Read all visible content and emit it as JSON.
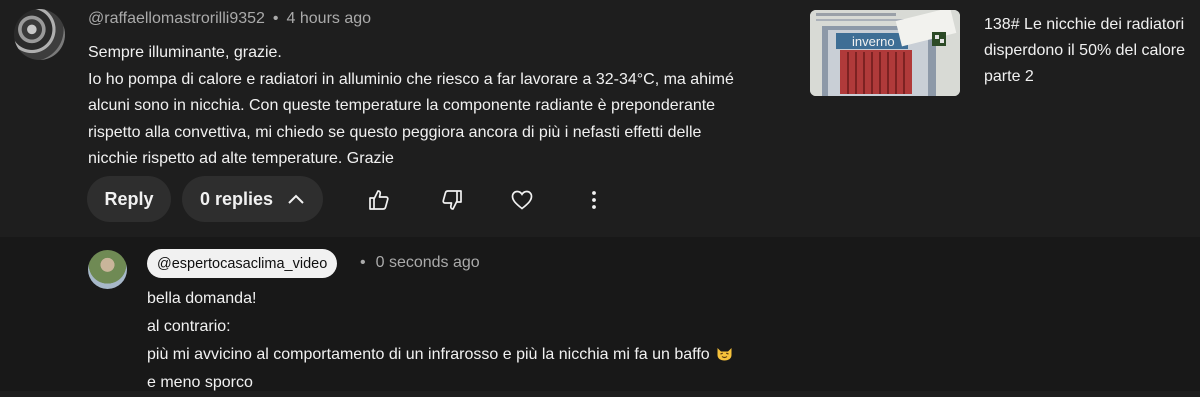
{
  "comment": {
    "author": "@raffaellomastrorilli9352",
    "separator": "•",
    "time": "4 hours ago",
    "lines": [
      "Sempre illuminante, grazie.",
      "Io ho pompa di calore e radiatori in alluminio che riesco a far lavorare a 32-34°C, ma ahimé",
      "alcuni sono in nicchia. Con queste temperature la componente radiante è preponderante",
      "rispetto alla convettiva, mi chiedo se questo peggiora ancora di più i nefasti effetti delle",
      "nicchie rispetto ad alte temperature. Grazie"
    ],
    "reply_label": "Reply",
    "replies_label": "0 replies"
  },
  "actions": {
    "icons": [
      "thumbs-up-icon",
      "thumbs-down-icon",
      "heart-icon",
      "more-vert-icon"
    ]
  },
  "video": {
    "thumbnail_caption": "inverno",
    "title_lines": [
      "138# Le nicchie dei radiatori",
      "disperdono il 50% del calore",
      "parte 2"
    ]
  },
  "reply": {
    "author": "@espertocasaclima_video",
    "separator": "•",
    "time": "0 seconds ago",
    "lines": [
      "bella domanda!",
      "al contrario:",
      "più mi avvicino al comportamento di un infrarosso e più la nicchia mi fa un baffo",
      "e meno sporco"
    ],
    "emoji_icon": "cat-emoji-icon"
  },
  "colors": {
    "background": "#1e1e1e",
    "reply_background": "#181818",
    "pill": "#2e2e2e",
    "text": "#f1f1f1",
    "secondary_text": "#aaaaaa"
  }
}
